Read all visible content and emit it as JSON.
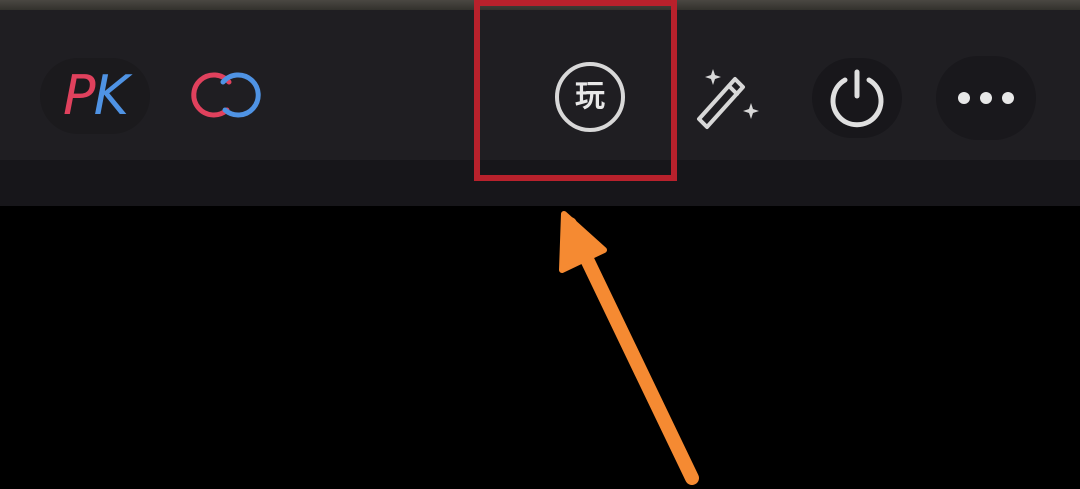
{
  "toolbar": {
    "pk_button": {
      "p": "P",
      "k": "K",
      "colors": {
        "p": "#e0415d",
        "k": "#4f93e4"
      }
    },
    "link_button": {
      "icon": "link-rings-icon",
      "colors": [
        "#e0415d",
        "#4f93e4"
      ]
    },
    "play_button": {
      "icon": "play-icon",
      "label": "玩"
    },
    "magic_wand_button": {
      "icon": "magic-wand-icon"
    },
    "power_button": {
      "icon": "power-icon"
    },
    "more_button": {
      "icon": "more-dots-icon"
    }
  },
  "annotation": {
    "highlight_color": "#b8212c",
    "arrow_color": "#f58a32",
    "target": "play_button"
  }
}
